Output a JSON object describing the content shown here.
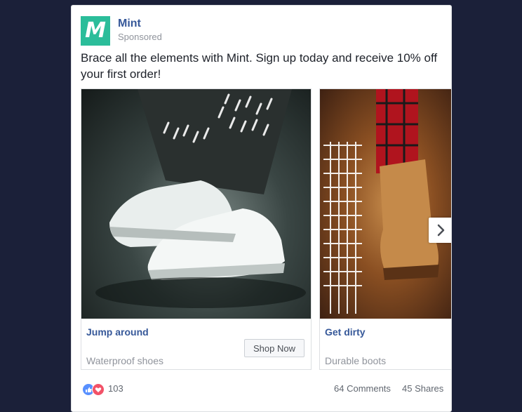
{
  "page": {
    "name": "Mint",
    "sponsored_label": "Sponsored",
    "logo_letter": "M",
    "logo_color": "#2bbd9a",
    "name_color": "#365899"
  },
  "post": {
    "text": "Brace all the elements with Mint. Sign up today and receive 10% off your first order!"
  },
  "carousel": {
    "cards": [
      {
        "title": "Jump around",
        "subtitle": "Waterproof shoes",
        "cta": "Shop Now",
        "image": "white-sneakers-in-rain-photo"
      },
      {
        "title": "Get dirty",
        "subtitle": "Durable boots",
        "image": "brown-boots-autumn-leaves-photo"
      }
    ],
    "next_icon": "chevron-right-icon"
  },
  "engagement": {
    "reaction_count": "103",
    "comments": "64 Comments",
    "shares": "45 Shares",
    "reactions": [
      "like-icon",
      "love-icon"
    ]
  }
}
